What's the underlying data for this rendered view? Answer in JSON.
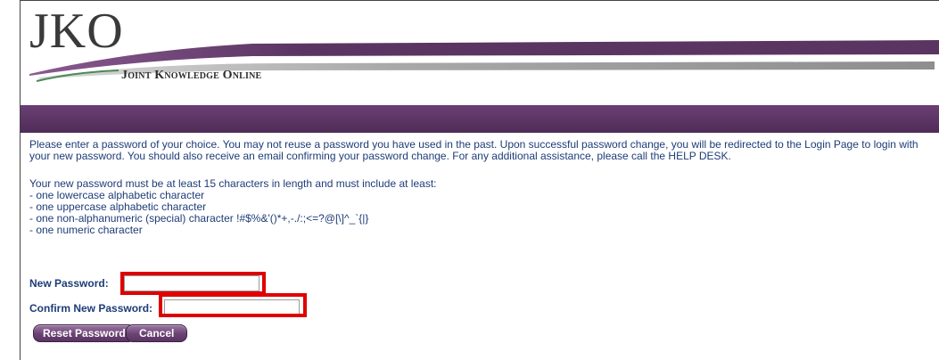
{
  "header": {
    "logo_text": "JKO",
    "logo_subtitle": "Joint Knowledge Online"
  },
  "instructions": {
    "intro": "Please enter a password of your choice. You may not reuse a password you have used in the past. Upon successful password change, you will be redirected to the Login Page to login with your new password. You should also receive an email confirming your password change. For any additional assistance, please call the HELP DESK.",
    "requirements_heading": "Your new password must be at least 15 characters in length and must include at least:",
    "requirements": [
      "- one lowercase alphabetic character",
      "- one uppercase alphabetic character",
      "- one non-alphanumeric (special) character !#$%&'()*+,-./:;<=?@[\\]^_`{|}",
      "- one numeric character"
    ]
  },
  "form": {
    "new_password_label": "New Password:",
    "new_password_value": "",
    "confirm_password_label": "Confirm New Password:",
    "confirm_password_value": ""
  },
  "buttons": {
    "reset_label": "Reset Password",
    "cancel_label": "Cancel"
  },
  "colors": {
    "brand_purple": "#5a3562",
    "text_blue": "#1d3c78",
    "highlight_red": "#e00000"
  }
}
